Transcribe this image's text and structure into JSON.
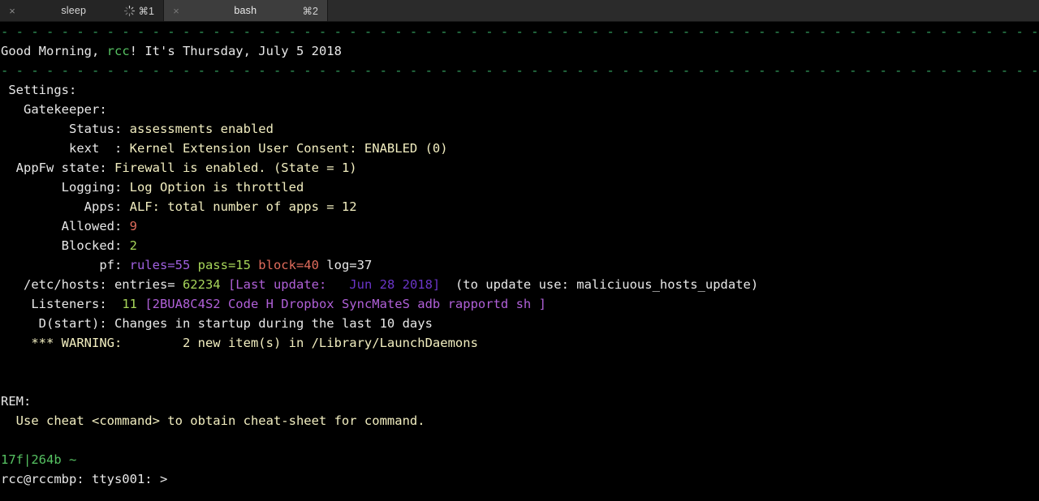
{
  "window": {
    "title": "bash"
  },
  "tabbar": {
    "tabs": [
      {
        "close_glyph": "×",
        "title": "sleep",
        "shortcut": "⌘1",
        "busy": true,
        "active": false
      },
      {
        "close_glyph": "×",
        "title": "bash",
        "shortcut": "⌘2",
        "busy": false,
        "active": true
      }
    ]
  },
  "colors": {
    "background": "#000000",
    "tabbar_background": "#2b2b2b",
    "tab_active": "#3d3d3d",
    "tab_inactive": "#252525",
    "green": "#56c262",
    "pale_yellow": "#f2eec0",
    "white": "#e8e8e8",
    "red": "#e06c5c",
    "magenta": "#b060d8",
    "deep_purple": "#6a35c8",
    "green_yellow": "#a8d65a",
    "rule_green": "#35a15f"
  },
  "terminal": {
    "rule_char": "- ",
    "greeting": {
      "prefix": "Good Morning, ",
      "user": "rcc",
      "suffix": "! It's Thursday, July 5 2018"
    },
    "settings_header": " Settings:",
    "gatekeeper_header": "   Gatekeeper:",
    "rows": [
      {
        "label": "         Status: ",
        "value": "assessments enabled"
      },
      {
        "label": "         kext  : ",
        "value": "Kernel Extension User Consent: ENABLED (0)"
      },
      {
        "label": "  AppFw state: ",
        "value": "Firewall is enabled. (State = 1)"
      },
      {
        "label": "        Logging: ",
        "value": "Log Option is throttled"
      },
      {
        "label": "           Apps: ",
        "value": "ALF: total number of apps = 12"
      }
    ],
    "allowed": {
      "label": "        Allowed: ",
      "value": "9"
    },
    "blocked": {
      "label": "        Blocked: ",
      "value": "2"
    },
    "pf": {
      "label": "             pf: ",
      "rules": "rules=55",
      "pass": " pass=15",
      "block": " block=40",
      "log": " log=37"
    },
    "hosts": {
      "label": "   /etc/hosts: entries= ",
      "entries": "62234",
      "update_open": " [Last update:  ",
      "update_date": " Jun 28 2018]",
      "hint": "  (to update use: maliciuous_hosts_update)"
    },
    "listeners": {
      "label": "    Listeners:  ",
      "count": "11",
      "list": " [2BUA8C4S2 Code H Dropbox SyncMateS adb rapportd sh ]"
    },
    "dstart": {
      "label": "     D(start): ",
      "value": "Changes in startup during the last 10 days"
    },
    "warning": {
      "text": "    *** WARNING:        2 new item(s) in /Library/LaunchDaemons"
    },
    "rem_header": "REM:",
    "rem_body": "  Use cheat <command> to obtain cheat-sheet for command.",
    "prompt": {
      "status": "17f|264b ~",
      "line": "rcc@rccmbp: ttys001: >"
    }
  }
}
